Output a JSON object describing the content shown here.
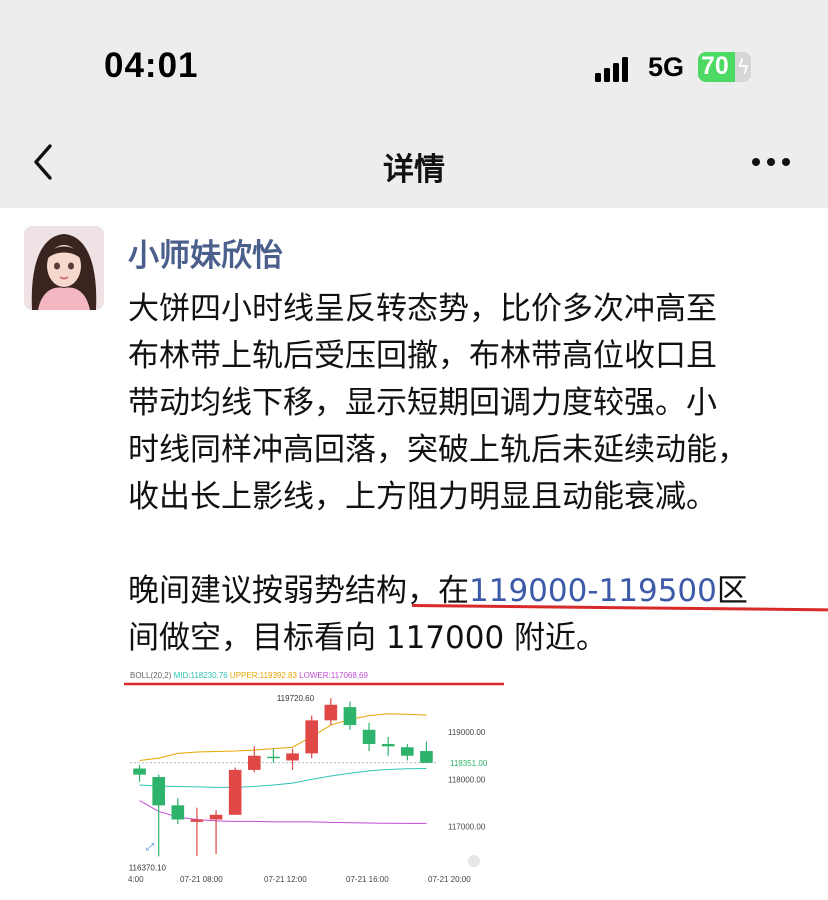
{
  "status_bar": {
    "time": "04:01",
    "network": "5G",
    "battery_level": "70",
    "battery_fraction": 0.7,
    "battery_color": "#4cd964"
  },
  "nav": {
    "back_icon": "chevron-left-icon",
    "title": "详情",
    "more_icon": "more-dots-icon"
  },
  "post": {
    "author": "小师妹欣怡",
    "author_color": "#4a5f8c",
    "paragraph1_lines": [
      "大饼四小时线呈反转态势，比价多次冲高至",
      "布林带上轨后受压回撤，布林带高位收口且",
      "带动均线下移，显示短期回调力度较强。小",
      "时线同样冲高回落，突破上轨后未延续动能，",
      "收出长上影线，上方阻力明显且动能衰减。"
    ],
    "paragraph2_line1_before": "晚间建议按弱势结构，在",
    "paragraph2_line1_highlight": "119000-119500",
    "paragraph2_line1_after": "区",
    "paragraph2_line2": "间做空，目标看向 117000 附近。",
    "highlight_color": "#3d5aa8",
    "underline_color": "#d82a2a"
  },
  "chart_data": {
    "type": "candlestick",
    "indicator": {
      "label": "BOLL(20,2)",
      "mid_label": "MID:118230.76",
      "upper_label": "UPPER:119392.83",
      "lower_label": "LOWER:117068.69",
      "mid_color": "#2ec4b6",
      "upper_color": "#e8a400",
      "lower_color": "#c24bd6"
    },
    "y_ticks": [
      "119000.00",
      "118000.00",
      "117000.00"
    ],
    "y_tick_values": [
      119000,
      118000,
      117000
    ],
    "ylim": [
      116250,
      119850
    ],
    "current_price": "118351.00",
    "current_price_value": 118351,
    "high_label": "119720.60",
    "low_label": "116370.10",
    "x_ticks": [
      "4:00",
      "07-21 08:00",
      "07-21 12:00",
      "07-21 16:00",
      "07-21 20:00"
    ],
    "up_color": "#e04848",
    "down_color": "#2db36b",
    "candles": [
      {
        "o": 118230,
        "h": 118300,
        "l": 117950,
        "c": 118100
      },
      {
        "o": 118050,
        "h": 118100,
        "l": 116370,
        "c": 117450
      },
      {
        "o": 117450,
        "h": 117600,
        "l": 117050,
        "c": 117150
      },
      {
        "o": 117100,
        "h": 117400,
        "l": 116380,
        "c": 117150
      },
      {
        "o": 117150,
        "h": 117350,
        "l": 116420,
        "c": 117250
      },
      {
        "o": 117250,
        "h": 118250,
        "l": 117250,
        "c": 118200
      },
      {
        "o": 118200,
        "h": 118700,
        "l": 118150,
        "c": 118500
      },
      {
        "o": 118480,
        "h": 118650,
        "l": 118350,
        "c": 118450
      },
      {
        "o": 118400,
        "h": 118650,
        "l": 118200,
        "c": 118550
      },
      {
        "o": 118550,
        "h": 119350,
        "l": 118450,
        "c": 119250
      },
      {
        "o": 119250,
        "h": 119720,
        "l": 119150,
        "c": 119580
      },
      {
        "o": 119530,
        "h": 119650,
        "l": 119050,
        "c": 119150
      },
      {
        "o": 119050,
        "h": 119200,
        "l": 118600,
        "c": 118750
      },
      {
        "o": 118750,
        "h": 118900,
        "l": 118500,
        "c": 118700
      },
      {
        "o": 118680,
        "h": 118750,
        "l": 118400,
        "c": 118500
      },
      {
        "o": 118600,
        "h": 118800,
        "l": 118350,
        "c": 118350
      }
    ],
    "upper_band": [
      118400,
      118450,
      118550,
      118580,
      118590,
      118600,
      118620,
      118650,
      118680,
      118900,
      119150,
      119270,
      119350,
      119390,
      119380,
      119360
    ],
    "mid_band": [
      117880,
      117860,
      117850,
      117840,
      117830,
      117830,
      117850,
      117880,
      117920,
      118000,
      118070,
      118130,
      118180,
      118210,
      118225,
      118230
    ],
    "lower_band": [
      117550,
      117320,
      117200,
      117150,
      117120,
      117110,
      117110,
      117100,
      117100,
      117100,
      117090,
      117080,
      117075,
      117070,
      117068,
      117068
    ]
  }
}
